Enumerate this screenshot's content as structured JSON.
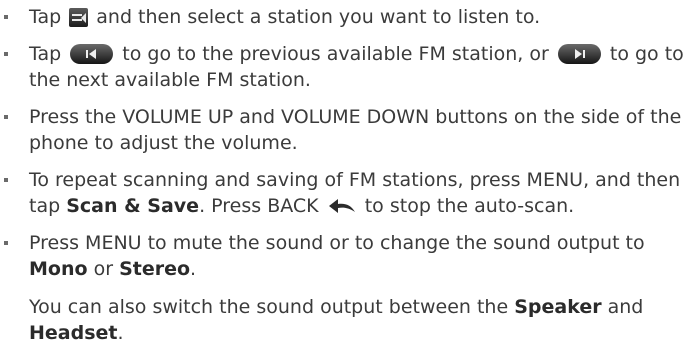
{
  "items": [
    {
      "before": "Tap",
      "after": "and then select a station you want to listen to."
    },
    {
      "before": "Tap",
      "middle": "to go to the previous available FM station, or",
      "after": "to go to the next available FM station."
    },
    {
      "text": "Press the VOLUME UP and VOLUME DOWN buttons on the side of the phone to adjust the volume."
    },
    {
      "before": "To repeat scanning and saving of FM stations, press MENU, and then tap",
      "scan_save": "Scan & Save",
      "middle": ". Press BACK",
      "after": "to stop the auto-scan."
    },
    {
      "before": "Press MENU to mute the sound or to change the sound output to",
      "mono": "Mono",
      "or": "or",
      "stereo": "Stereo",
      "end": ".",
      "extra_before": "You can also switch the sound output between the",
      "speaker": "Speaker",
      "and": "and",
      "headset": "Headset",
      "extra_end": "."
    }
  ],
  "icons": {
    "menu": "menu-button-icon",
    "previous": "previous-station-icon",
    "next": "next-station-icon",
    "back": "back-arrow-icon"
  }
}
